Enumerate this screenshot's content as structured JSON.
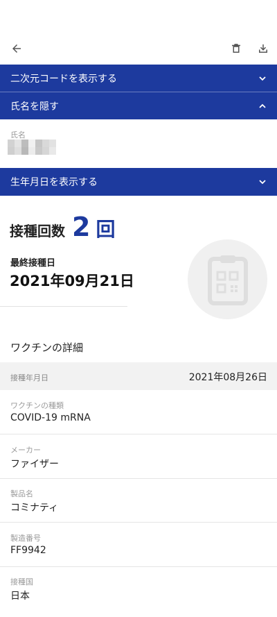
{
  "toolbar": {
    "back_icon": "arrow-left-icon",
    "delete_icon": "trash-icon",
    "download_icon": "download-icon"
  },
  "sections": {
    "qr_toggle": {
      "label": "二次元コードを表示する",
      "state": "collapsed"
    },
    "name_toggle": {
      "label": "氏名を隠す",
      "state": "expanded"
    },
    "dob_toggle": {
      "label": "生年月日を表示する",
      "state": "collapsed"
    }
  },
  "name_block": {
    "label": "氏名",
    "value_masked": true
  },
  "summary": {
    "dose_title": "接種回数",
    "dose_count": "2",
    "dose_unit": "回",
    "last_date_label": "最終接種日",
    "last_date": "2021年09月21日"
  },
  "details": {
    "title": "ワクチンの詳細",
    "date_row": {
      "label": "接種年月日",
      "value": "2021年08月26日"
    },
    "fields": [
      {
        "label": "ワクチンの種類",
        "value": "COVID-19 mRNA"
      },
      {
        "label": "メーカー",
        "value": "ファイザー"
      },
      {
        "label": "製品名",
        "value": "コミナティ"
      },
      {
        "label": "製造番号",
        "value": "FF9942"
      },
      {
        "label": "接種国",
        "value": "日本"
      }
    ]
  },
  "colors": {
    "accent": "#1d3a9e",
    "background": "#ffffff",
    "muted": "#9a9a9a"
  }
}
